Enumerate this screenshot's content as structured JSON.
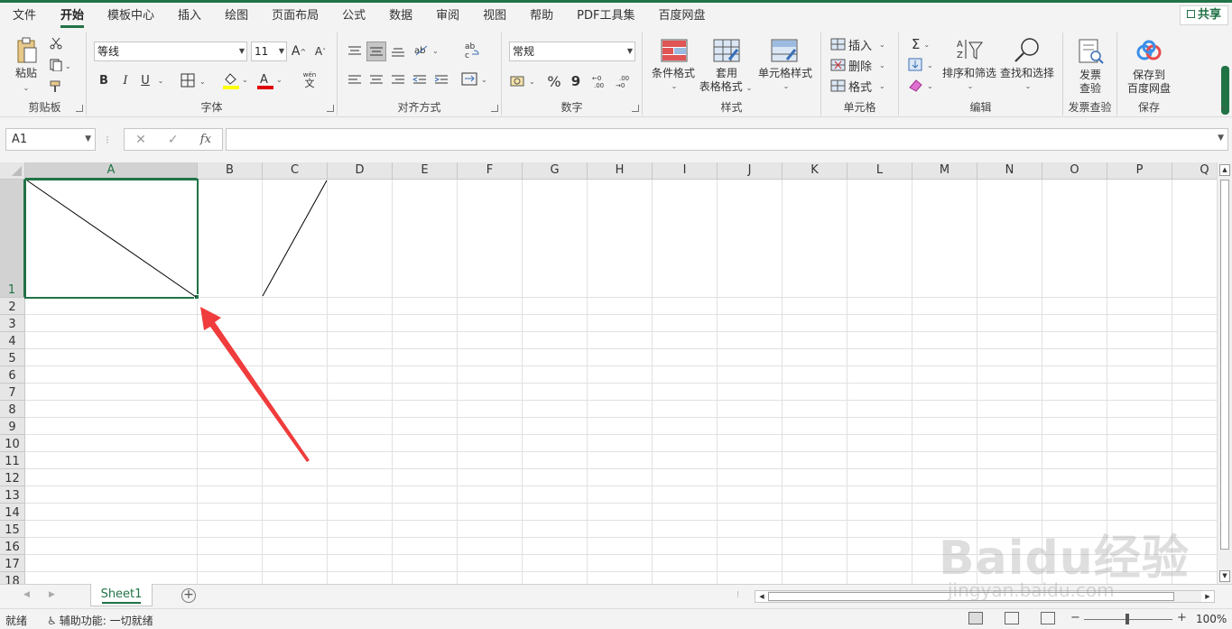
{
  "ribbon_tabs": [
    "文件",
    "开始",
    "模板中心",
    "插入",
    "绘图",
    "页面布局",
    "公式",
    "数据",
    "审阅",
    "视图",
    "帮助",
    "PDF工具集",
    "百度网盘"
  ],
  "share_label": "共享",
  "clipboard": {
    "paste": "粘贴",
    "label": "剪贴板"
  },
  "font": {
    "name": "等线",
    "size": "11",
    "bold": "B",
    "italic": "I",
    "underline": "U",
    "label": "字体",
    "grow": "A",
    "shrink": "A",
    "color_a": "A",
    "phonetic": "wén",
    "phonetic_char": "文"
  },
  "alignment": {
    "label": "对齐方式"
  },
  "number": {
    "format": "常规",
    "percent": "%",
    "comma": "9",
    "label": "数字"
  },
  "styles": {
    "conditional": "条件格式",
    "table1": "套用",
    "table2": "表格格式",
    "cell_style": "单元格样式",
    "label": "样式"
  },
  "cells": {
    "insert": "插入",
    "delete": "删除",
    "format": "格式",
    "label": "单元格"
  },
  "editing": {
    "sigma": "Σ",
    "sort": "排序和筛选",
    "find": "查找和选择",
    "label": "编辑"
  },
  "invoice": {
    "btn1": "发票",
    "btn2": "查验",
    "label": "发票查验"
  },
  "save": {
    "btn1": "保存到",
    "btn2": "百度网盘",
    "label": "保存"
  },
  "formula_bar": {
    "name_box": "A1",
    "sep": "⁝",
    "cancel": "✕",
    "enter": "✓",
    "fx": "fx",
    "content": ""
  },
  "columns": [
    "A",
    "B",
    "C",
    "D",
    "E",
    "F",
    "G",
    "H",
    "I",
    "J",
    "K",
    "L",
    "M",
    "N",
    "O",
    "P",
    "Q"
  ],
  "rows": [
    "1",
    "2",
    "3",
    "4",
    "5",
    "6",
    "7",
    "8",
    "9",
    "10",
    "11",
    "12",
    "13",
    "14",
    "15",
    "16",
    "17",
    "18"
  ],
  "selected_cell": "A1",
  "sheets": [
    "Sheet1"
  ],
  "add_sheet": "+",
  "status": {
    "ready": "就绪",
    "accessibility": "辅助功能: 一切就绪",
    "zoom": "100%",
    "minus": "−",
    "plus": "+"
  },
  "watermark": {
    "text": "Baidu经验",
    "sub": "jingyan.baidu.com"
  },
  "colors": {
    "accent": "#217346",
    "arrow": "#f03c3c"
  },
  "icons": [
    "paste-icon",
    "cut-icon",
    "copy-icon",
    "format-painter-icon",
    "border-icon",
    "fill-color-icon",
    "font-color-icon",
    "wrap-text-icon",
    "merge-icon",
    "currency-icon",
    "conditional-format-icon",
    "table-format-icon",
    "cell-style-icon",
    "sort-filter-icon",
    "find-icon",
    "invoice-icon",
    "baidu-cloud-icon",
    "accessibility-icon",
    "normal-view-icon",
    "page-layout-icon",
    "page-break-icon",
    "arrow-annotation-icon"
  ]
}
